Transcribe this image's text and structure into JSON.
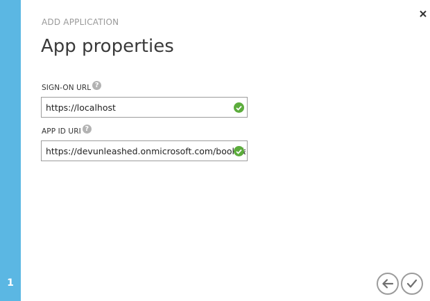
{
  "wizard": {
    "step_number": "1",
    "supertitle": "ADD APPLICATION",
    "title": "App properties"
  },
  "fields": {
    "sign_on_url": {
      "label": "SIGN-ON URL",
      "help_icon": "?",
      "value": "https://localhost",
      "status_icon": "check-circle-icon"
    },
    "app_id_uri": {
      "label": "APP ID URI",
      "help_icon": "?",
      "value": "https://devunleashed.onmicrosoft.com/book-fast-",
      "status_icon": "check-circle-icon"
    }
  },
  "icons": {
    "close": "close-icon",
    "back": "arrow-left-icon",
    "complete": "checkmark-icon"
  },
  "colors": {
    "step_rail": "#5bb7e3",
    "valid": "#5cac3c",
    "nav_border": "#9b9b9b"
  }
}
